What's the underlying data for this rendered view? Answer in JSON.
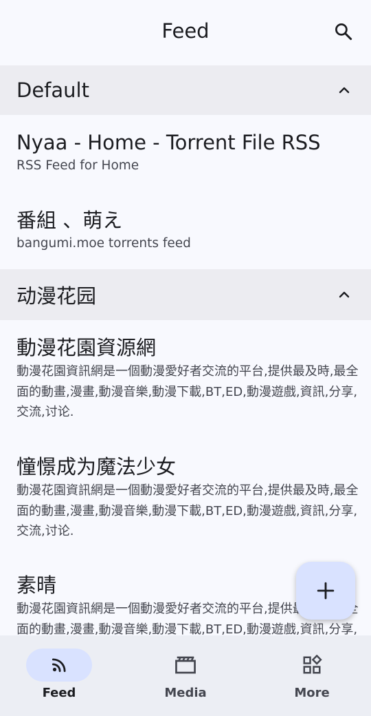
{
  "topbar": {
    "title": "Feed"
  },
  "groups": [
    {
      "name": "Default",
      "items": [
        {
          "title": "Nyaa - Home - Torrent File RSS",
          "subtitle": "RSS Feed for Home"
        },
        {
          "title": "番組 、萌え",
          "subtitle": "bangumi.moe torrents feed"
        }
      ]
    },
    {
      "name": "动漫花园",
      "items": [
        {
          "title": "動漫花園資源網",
          "description": "動漫花園資訊網是一個動漫愛好者交流的平台,提供最及時,最全面的動畫,漫畫,動漫音樂,動漫下載,BT,ED,動漫遊戲,資訊,分享,交流,讨论."
        },
        {
          "title": "憧憬成为魔法少女",
          "description": "動漫花園資訊網是一個動漫愛好者交流的平台,提供最及時,最全面的動畫,漫畫,動漫音樂,動漫下載,BT,ED,動漫遊戲,資訊,分享,交流,讨论."
        },
        {
          "title": "素晴",
          "description": "動漫花園資訊網是一個動漫愛好者交流的平台,提供最及時,最全面的動畫,漫畫,動漫音樂,動漫下載,BT,ED,動漫遊戲,資訊,分享,交流,讨论."
        }
      ]
    }
  ],
  "fab": {
    "icon": "plus-icon"
  },
  "bottom_nav": [
    {
      "label": "Feed",
      "icon": "rss-icon",
      "active": true
    },
    {
      "label": "Media",
      "icon": "clapperboard-icon",
      "active": false
    },
    {
      "label": "More",
      "icon": "widgets-icon",
      "active": false
    }
  ],
  "colors": {
    "accent_container": "#d9e2ff",
    "background": "#f8f9fe",
    "group_header": "#ececf1",
    "nav_bar": "#eceef4"
  }
}
